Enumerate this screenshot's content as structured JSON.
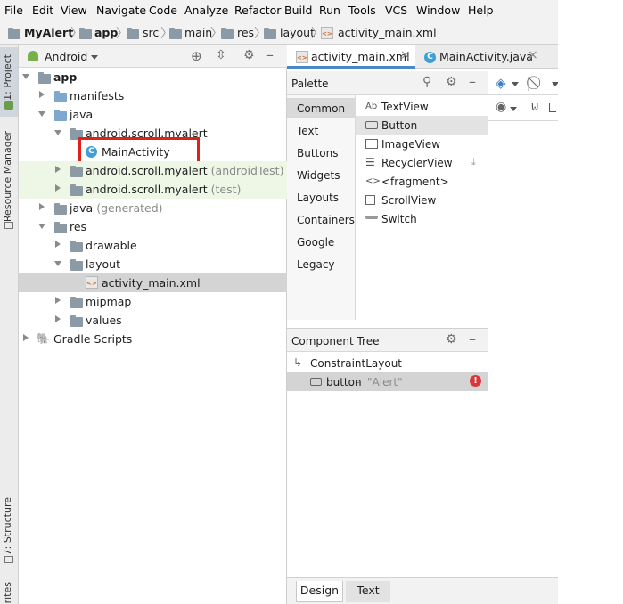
{
  "menu": [
    "File",
    "Edit",
    "View",
    "Navigate",
    "Code",
    "Analyze",
    "Refactor",
    "Build",
    "Run",
    "Tools",
    "VCS",
    "Window",
    "Help"
  ],
  "breadcrumb": [
    "MyAlert",
    "app",
    "src",
    "main",
    "res",
    "layout",
    "activity_main.xml"
  ],
  "left_strip": {
    "project_tab": "1: Project",
    "resource_manager_tab": "Resource Manager",
    "structure_tab": "7: Structure",
    "favorites_tab": "orites"
  },
  "project": {
    "view_selector": "Android",
    "tree": [
      {
        "label": "app",
        "bold": true
      },
      {
        "label": "manifests"
      },
      {
        "label": "java"
      },
      {
        "label": "android.scroll.myalert"
      },
      {
        "label": "MainActivity"
      },
      {
        "label": "android.scroll.myalert",
        "extra": "(androidTest)"
      },
      {
        "label": "android.scroll.myalert",
        "extra": "(test)"
      },
      {
        "label": "java",
        "extra": "(generated)"
      },
      {
        "label": "res"
      },
      {
        "label": "drawable"
      },
      {
        "label": "layout"
      },
      {
        "label": "activity_main.xml"
      },
      {
        "label": "mipmap"
      },
      {
        "label": "values"
      },
      {
        "label": "Gradle Scripts"
      }
    ]
  },
  "editor": {
    "tabs": [
      {
        "label": "activity_main.xml",
        "active": true
      },
      {
        "label": "MainActivity.java",
        "active": false
      }
    ],
    "close_glyph": "×"
  },
  "palette": {
    "title": "Palette",
    "categories": [
      "Common",
      "Text",
      "Buttons",
      "Widgets",
      "Layouts",
      "Containers",
      "Google",
      "Legacy"
    ],
    "selected_category": "Common",
    "items": [
      {
        "label": "TextView",
        "icon": "Ab"
      },
      {
        "label": "Button",
        "icon": "button-icon"
      },
      {
        "label": "ImageView",
        "icon": "image-icon"
      },
      {
        "label": "RecyclerView",
        "icon": "list-icon"
      },
      {
        "label": "<fragment>",
        "icon": "<>"
      },
      {
        "label": "ScrollView",
        "icon": "scroll-icon"
      },
      {
        "label": "Switch",
        "icon": "switch-icon"
      }
    ],
    "selected_item": "Button"
  },
  "component_tree": {
    "title": "Component Tree",
    "root": "ConstraintLayout",
    "child": {
      "name": "button",
      "separator": "- ",
      "text": "\"Alert\""
    }
  },
  "bottom_tabs": [
    "Design",
    "Text"
  ],
  "colors": {
    "highlight_box": "#e0211a",
    "class_icon": "#3fa0d8",
    "error": "#d9363e",
    "layers_icon": "#3c7fc7"
  }
}
